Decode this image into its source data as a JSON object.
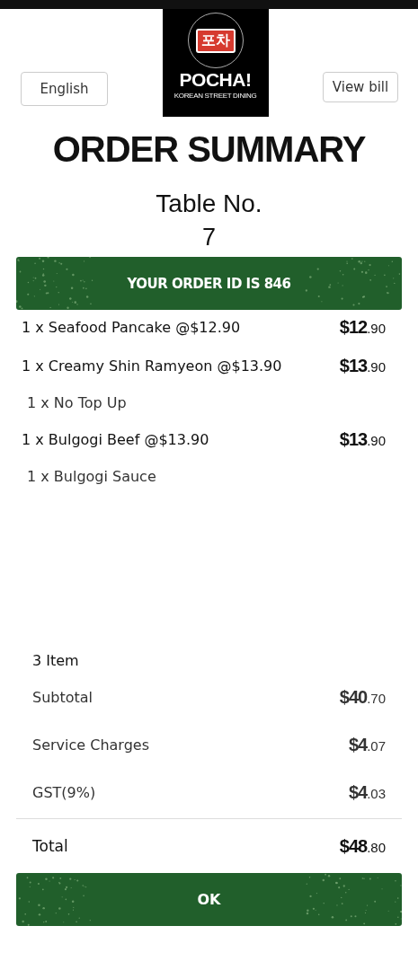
{
  "header": {
    "language_button": "English",
    "logo": {
      "korean": "포차",
      "name": "POCHA!",
      "tagline": "KOREAN STREET DINING"
    },
    "bill_button": "View bill"
  },
  "title": "ORDER SUMMARY",
  "table": {
    "label": "Table No.",
    "number": "7"
  },
  "order_banner": "YOUR ORDER ID IS 846",
  "items": [
    {
      "name": "1 x Seafood Pancake @$12.90",
      "price": "$12.90"
    },
    {
      "name": "1 x Creamy Shin Ramyeon @$13.90",
      "price": "$13.90",
      "addons": [
        "1 x No Top Up"
      ]
    },
    {
      "name": "1 x Bulgogi Beef @$13.90",
      "price": "$13.90",
      "addons": [
        "1 x Bulgogi Sauce"
      ]
    }
  ],
  "summary": {
    "count": "3 Item",
    "lines": [
      {
        "label": "Subtotal",
        "amount": "$40.70"
      },
      {
        "label": "Service Charges",
        "amount": "$4.07"
      },
      {
        "label": "GST(9%)",
        "amount": "$4.03"
      }
    ],
    "total": {
      "label": "Total",
      "amount": "$48.80"
    }
  },
  "ok_button": "OK"
}
